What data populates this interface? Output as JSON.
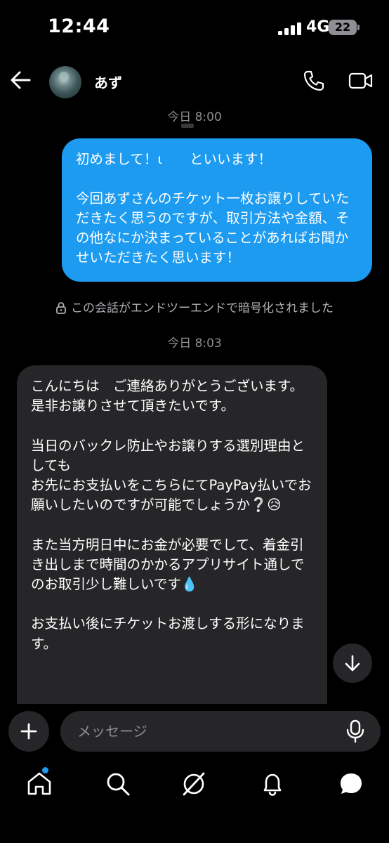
{
  "status_bar": {
    "time": "12:44",
    "network": "4G",
    "battery": "22"
  },
  "header": {
    "contact_name": "あず",
    "back_icon": "arrow-left-icon",
    "call_icon": "phone-icon",
    "video_icon": "video-camera-icon"
  },
  "conversation": {
    "timestamp_1": "今日 8:00",
    "outgoing_message": "初めまして！ι　　といいます！\n\n今回あずさんのチケット一枚お譲りしていただきたく思うのですが、取引方法や金額、その他なにか決まっていることがあればお聞かせいただきたく思います！",
    "e2e_notice": "この会話がエンドツーエンドで暗号化されました",
    "timestamp_2": "今日 8:03",
    "incoming_message": "こんにちは　ご連絡ありがとうございます。\n是非お譲りさせて頂きたいです。\n\n当日のバックレ防止やお譲りする選別理由としても\nお先にお支払いをこちらにてPayPay払いでお願いしたいのですが可能でしょうか❔😥\n\nまた当方明日中にお金が必要でして、着金引き出しまで時間のかかるアプリサイト通しでのお取引少し難しいです💧\n\nお支払い後にチケットお渡しする形になります。"
  },
  "composer": {
    "placeholder": "メッセージ"
  },
  "colors": {
    "accent": "#1d9bf0",
    "bubble_incoming": "#262628",
    "background": "#000000"
  }
}
